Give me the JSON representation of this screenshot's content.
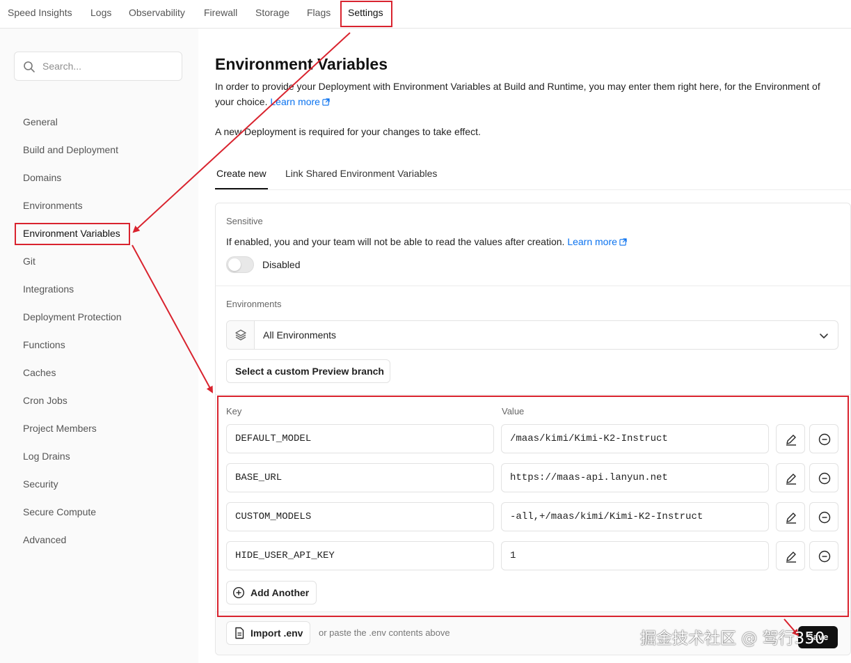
{
  "topnav": {
    "tabs": [
      "Speed Insights",
      "Logs",
      "Observability",
      "Firewall",
      "Storage",
      "Flags",
      "Settings"
    ],
    "active": "Settings"
  },
  "sidebar": {
    "search_placeholder": "Search...",
    "items": [
      "General",
      "Build and Deployment",
      "Domains",
      "Environments",
      "Environment Variables",
      "Git",
      "Integrations",
      "Deployment Protection",
      "Functions",
      "Caches",
      "Cron Jobs",
      "Project Members",
      "Log Drains",
      "Security",
      "Secure Compute",
      "Advanced"
    ],
    "active": "Environment Variables"
  },
  "main": {
    "title": "Environment Variables",
    "description": "In order to provide your Deployment with Environment Variables at Build and Runtime, you may enter them right here, for the Environment of your choice.",
    "learn_more": "Learn more",
    "note": "A new Deployment is required for your changes to take effect.",
    "tabs": [
      "Create new",
      "Link Shared Environment Variables"
    ],
    "sensitive": {
      "label": "Sensitive",
      "text": "If enabled, you and your team will not be able to read the values after creation.",
      "learn_more": "Learn more",
      "toggle_state": "Disabled"
    },
    "environments": {
      "label": "Environments",
      "selected": "All Environments",
      "custom_branch_button": "Select a custom Preview branch"
    },
    "kv": {
      "key_header": "Key",
      "value_header": "Value",
      "rows": [
        {
          "key": "DEFAULT_MODEL",
          "value": "/maas/kimi/Kimi-K2-Instruct"
        },
        {
          "key": "BASE_URL",
          "value": "https://maas-api.lanyun.net"
        },
        {
          "key": "CUSTOM_MODELS",
          "value": "-all,+/maas/kimi/Kimi-K2-Instruct"
        },
        {
          "key": "HIDE_USER_API_KEY",
          "value": "1"
        }
      ],
      "add_another": "Add Another"
    },
    "footer": {
      "import_button": "Import .env",
      "hint": "or paste the .env contents above",
      "save_button": "Save"
    }
  },
  "watermark": "掘金技术社区 @ 驾行350",
  "colors": {
    "accent": "#0a72ef",
    "highlight": "#d9232e"
  }
}
